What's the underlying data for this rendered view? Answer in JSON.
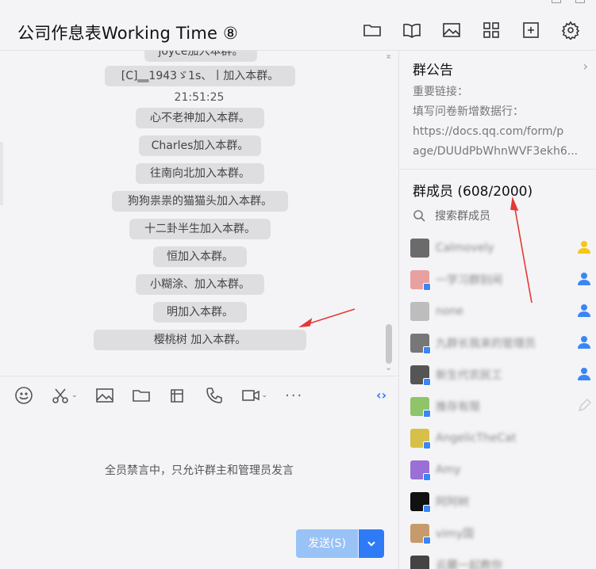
{
  "header": {
    "title": "公司作息表Working Time ⑧",
    "toolbar": [
      "folder-icon",
      "book-icon",
      "image-icon",
      "apps-icon",
      "add-box-icon",
      "gear-icon"
    ]
  },
  "chat": {
    "messages": [
      {
        "text": "joyce加入本群。"
      },
      {
        "text": "[C]‗‗1943ゞ1s、丨加入本群。"
      },
      {
        "time": "21:51:25"
      },
      {
        "text": "心不老神加入本群。"
      },
      {
        "text": "Charles加入本群。"
      },
      {
        "text": "往南向北加入本群。"
      },
      {
        "text": "狗狗祟祟的猫猫头加入本群。"
      },
      {
        "text": "十二卦半生加入本群。"
      },
      {
        "text": "恒加入本群。"
      },
      {
        "text": "小糊涂、加入本群。"
      },
      {
        "text": "明加入本群。"
      },
      {
        "text": "樱桃树                        加入本群。"
      }
    ]
  },
  "compose": {
    "tools": [
      "emoji-icon",
      "scissors-icon",
      "image-icon",
      "folder-icon",
      "screenshot-icon",
      "phone-icon",
      "video-icon",
      "more-icon"
    ],
    "more_label": "···",
    "mute_notice": "全员禁言中，只允许群主和管理员发言",
    "send_label": "发送(S)",
    "collapse_label": "‹›"
  },
  "panel": {
    "notice_title": "群公告",
    "notice_lines": [
      "重要链接：",
      "填写问卷新增数据行：",
      "https://docs.qq.com/form/p",
      "age/DUUdPbWhnWVF3ekh6..."
    ],
    "members_title": "群成员 (608/2000)",
    "search_placeholder": "搜索群成员",
    "members": [
      {
        "name": "Calmovely",
        "role": "owner",
        "color": "#6b6b6b"
      },
      {
        "name": "一学习群别闲",
        "role": "admin",
        "color": "#e9a0a0"
      },
      {
        "name": "none",
        "role": "admin",
        "color": "#bdbdbd"
      },
      {
        "name": "九群长我来的管理员",
        "role": "admin",
        "color": "#777777"
      },
      {
        "name": "新生代农民工",
        "role": "admin",
        "color": "#555555"
      },
      {
        "name": "推存有限",
        "role": "none",
        "color": "#8fc46a"
      },
      {
        "name": "AngelicTheCat",
        "role": "none",
        "color": "#d6c04a"
      },
      {
        "name": "Amy",
        "role": "none",
        "color": "#9a6fd6"
      },
      {
        "name": "阿阿树",
        "role": "none",
        "color": "#111111"
      },
      {
        "name": "vimy国",
        "role": "none",
        "color": "#c79a6b"
      },
      {
        "name": "云麓一起教你",
        "role": "none",
        "color": "#444444"
      }
    ]
  },
  "colors": {
    "accent": "#2f7bf5",
    "arrow": "#e53935",
    "owner": "#f5c518",
    "admin": "#3b86f7"
  }
}
